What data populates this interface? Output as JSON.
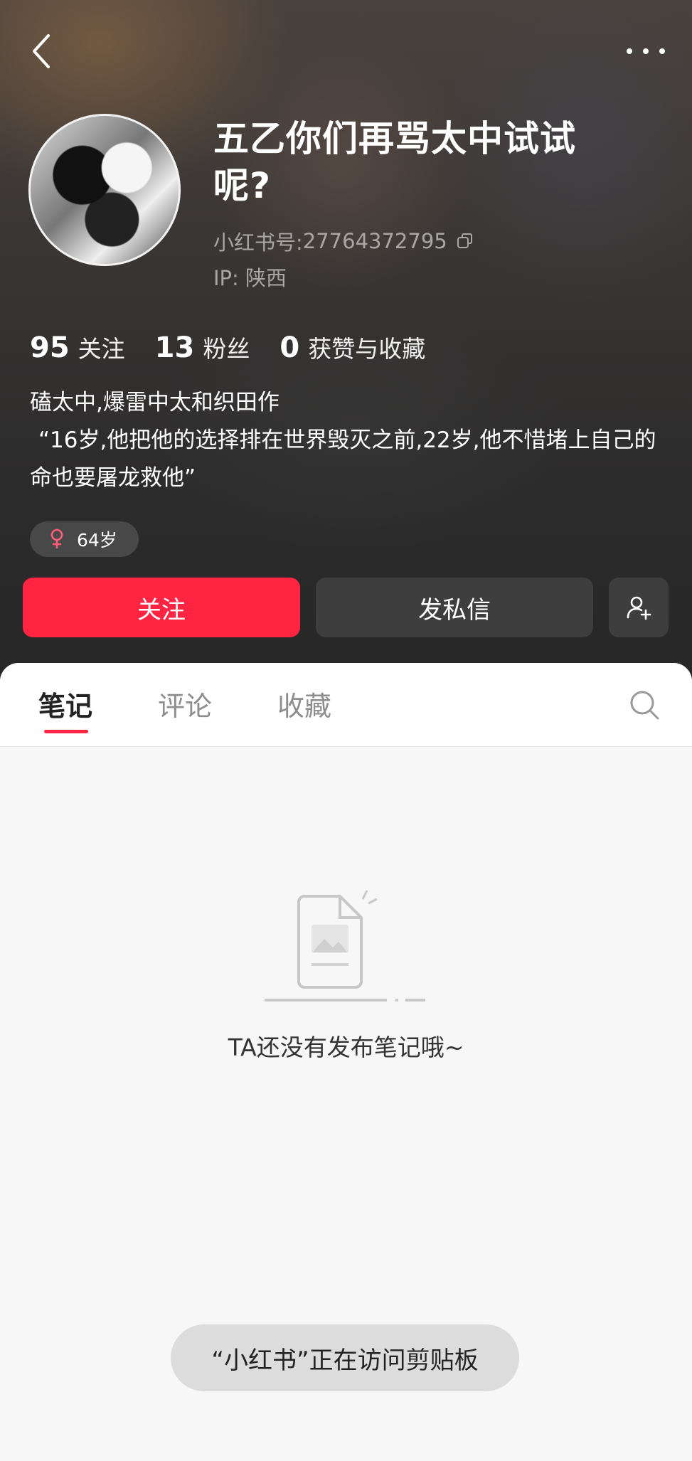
{
  "profile": {
    "name": "五乙你们再骂太中试试呢?",
    "uid_label": "小红书号:",
    "uid_value": "27764372795",
    "ip_label": "IP:",
    "ip_value": "陕西",
    "stats": [
      {
        "num": "95",
        "label": "关注"
      },
      {
        "num": "13",
        "label": "粉丝"
      },
      {
        "num": "0",
        "label": "获赞与收藏"
      }
    ],
    "bio_line1": "磕太中,爆雷中太和织田作",
    "bio_line2": "“16岁,他把他的选择排在世界毁灭之前,22岁,他不惜堵上自己的命也要屠龙救他”",
    "tag": "64岁"
  },
  "actions": {
    "follow": "关注",
    "message": "发私信"
  },
  "tabs": [
    {
      "label": "笔记",
      "active": true
    },
    {
      "label": "评论",
      "active": false
    },
    {
      "label": "收藏",
      "active": false
    }
  ],
  "empty_state": "TA还没有发布笔记哦~",
  "toast": "“小红书”正在访问剪贴板",
  "colors": {
    "accent": "#ff2442",
    "gender": "#ff5c7a"
  }
}
